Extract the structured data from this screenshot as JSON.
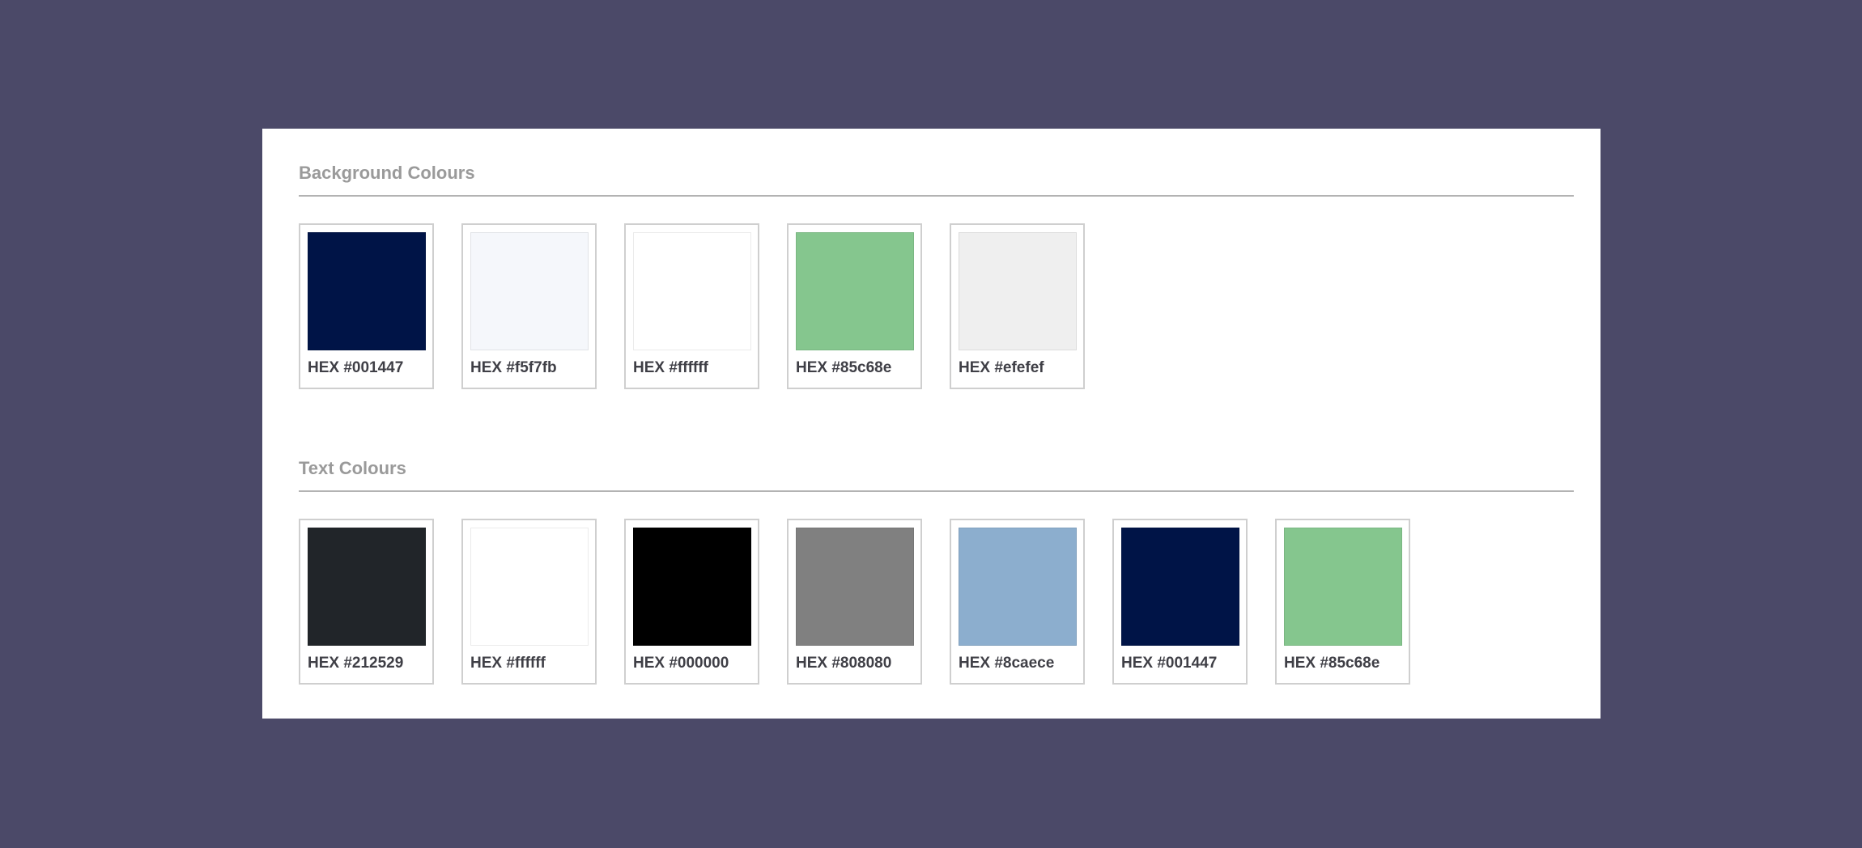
{
  "background_section": {
    "title": "Background Colours",
    "swatches": [
      {
        "hex": "#001447",
        "label": "HEX #001447"
      },
      {
        "hex": "#f5f7fb",
        "label": "HEX #f5f7fb"
      },
      {
        "hex": "#ffffff",
        "label": "HEX #ffffff"
      },
      {
        "hex": "#85c68e",
        "label": "HEX #85c68e"
      },
      {
        "hex": "#efefef",
        "label": "HEX #efefef"
      }
    ]
  },
  "text_section": {
    "title": "Text Colours",
    "swatches": [
      {
        "hex": "#212529",
        "label": "HEX #212529"
      },
      {
        "hex": "#ffffff",
        "label": "HEX #ffffff"
      },
      {
        "hex": "#000000",
        "label": "HEX #000000"
      },
      {
        "hex": "#808080",
        "label": "HEX #808080"
      },
      {
        "hex": "#8caece",
        "label": "HEX #8caece"
      },
      {
        "hex": "#001447",
        "label": "HEX #001447"
      },
      {
        "hex": "#85c68e",
        "label": "HEX #85c68e"
      }
    ]
  },
  "page_background": "#4b4968"
}
